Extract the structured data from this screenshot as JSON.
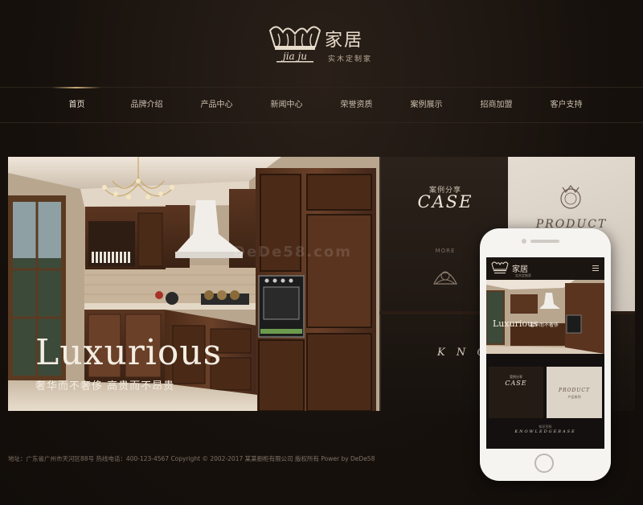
{
  "header": {
    "logo_cn": "家居",
    "logo_en": "jia ju",
    "logo_sub": "实木定制家"
  },
  "nav": {
    "items": [
      {
        "label": "首页",
        "active": true
      },
      {
        "label": "品牌介绍",
        "active": false
      },
      {
        "label": "产品中心",
        "active": false
      },
      {
        "label": "新闻中心",
        "active": false
      },
      {
        "label": "荣誉资质",
        "active": false
      },
      {
        "label": "案例展示",
        "active": false
      },
      {
        "label": "招商加盟",
        "active": false
      },
      {
        "label": "客户支持",
        "active": false
      }
    ]
  },
  "banner": {
    "title": "Luxurious",
    "subtitle": "奢华而不奢侈 高贵而不昂贵",
    "watermark": "DeDe58.com",
    "case_cn": "案例分享",
    "case_en": "CASE",
    "more_label": "MORE",
    "product_en": "PRODUCT",
    "know_en": "K N O W"
  },
  "phone": {
    "logo_cn": "家居",
    "logo_sub": "实木定制家",
    "lux": "Luxurious",
    "lux_sub": "奢华而不奢侈",
    "case_cn": "案例分享",
    "case_en": "CASE",
    "product_en": "PRODUCT",
    "product_cn": "产品系列",
    "know_cn": "知识百科",
    "know_en": "KNOWLEDGEBASE"
  },
  "footer": {
    "text": "地址：广东省广州市天河区88号 热线电话：400-123-4567 Copyright © 2002-2017 某某橱柜有限公司 版权所有 Power by DeDe58"
  },
  "colors": {
    "background": "#1a1410",
    "accent_gold": "#c8aa78",
    "text_light": "#d8cbb8"
  }
}
